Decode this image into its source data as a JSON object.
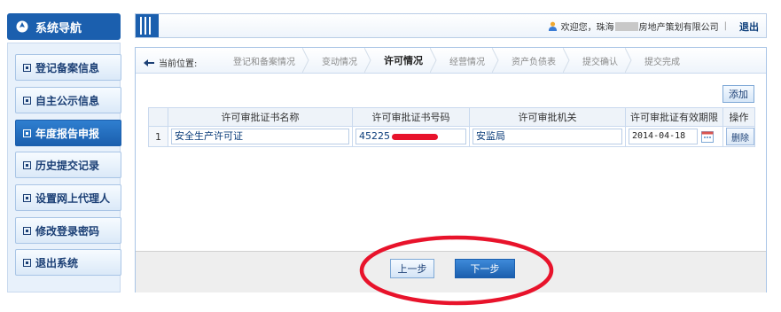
{
  "nav": {
    "title": "系统导航",
    "items": [
      {
        "label": "登记备案信息"
      },
      {
        "label": "自主公示信息"
      },
      {
        "label": "年度报告申报"
      },
      {
        "label": "历史提交记录"
      },
      {
        "label": "设置网上代理人"
      },
      {
        "label": "修改登录密码"
      },
      {
        "label": "退出系统"
      }
    ]
  },
  "header": {
    "welcome_prefix": "欢迎您，珠海",
    "welcome_suffix": "房地产策划有限公司",
    "separator": "|",
    "logout": "退出"
  },
  "breadcrumb": {
    "label": "当前位置:",
    "steps": [
      "登记和备案情况",
      "变动情况",
      "许可情况",
      "经营情况",
      "资产负债表",
      "提交确认",
      "提交完成"
    ]
  },
  "table": {
    "add_label": "添加",
    "columns": [
      "",
      "许可审批证书名称",
      "许可审批证书号码",
      "许可审批机关",
      "许可审批证有效期限",
      "操作"
    ],
    "rows": [
      {
        "index": "1",
        "name": "安全生产许可证",
        "number": "45225",
        "authority": "安监局",
        "expiry": "2014-04-18",
        "action": "删除"
      }
    ]
  },
  "footer": {
    "prev_label": "上一步",
    "next_label": "下一步"
  },
  "colors": {
    "brand_blue": "#1b5fae",
    "highlight_red": "#e8132b"
  },
  "icons": [
    "compass-icon",
    "user-icon",
    "location-icon",
    "calendar-icon"
  ]
}
